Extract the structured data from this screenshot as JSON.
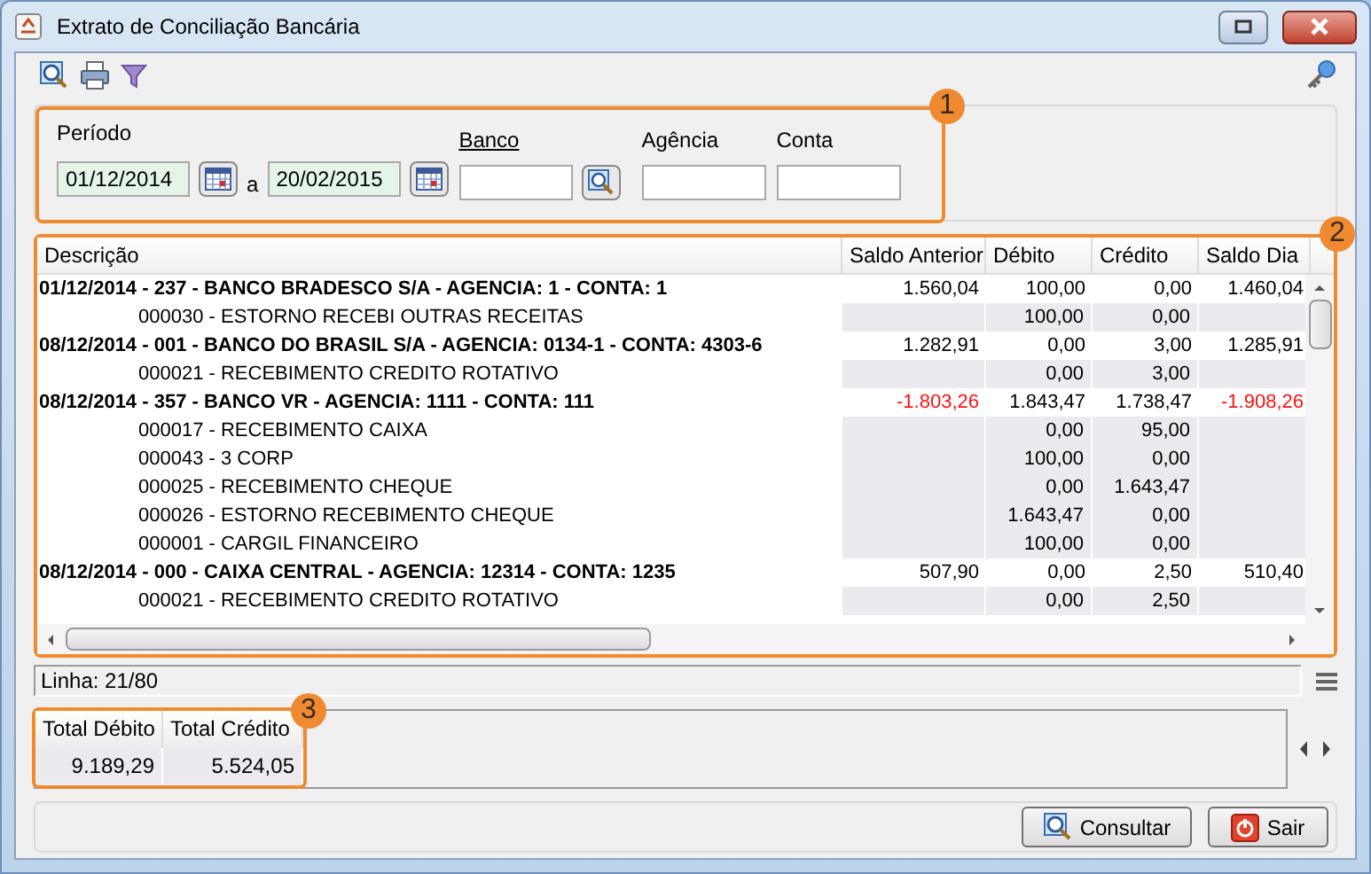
{
  "window": {
    "title": "Extrato de Conciliação Bancária"
  },
  "filters": {
    "periodo_label": "Período",
    "date_from": "01/12/2014",
    "separator": "a",
    "date_to": "20/02/2015",
    "banco_label": "Banco",
    "agencia_label": "Agência",
    "conta_label": "Conta"
  },
  "badges": [
    "1",
    "2",
    "3"
  ],
  "table": {
    "columns": [
      "Descrição",
      "Saldo Anterior",
      "Débito",
      "Crédito",
      "Saldo Dia"
    ],
    "rows": [
      {
        "kind": "group",
        "negative": false,
        "cells": [
          "01/12/2014 - 237 - BANCO BRADESCO S/A  - AGENCIA: 1 - CONTA: 1",
          "1.560,04",
          "100,00",
          "0,00",
          "1.460,04"
        ]
      },
      {
        "kind": "detail",
        "cells": [
          "000030 - ESTORNO RECEBI OUTRAS RECEITAS",
          "",
          "100,00",
          "0,00",
          ""
        ]
      },
      {
        "kind": "group",
        "negative": false,
        "cells": [
          "08/12/2014 - 001 - BANCO DO BRASIL S/A - AGENCIA: 0134-1 - CONTA: 4303-6",
          "1.282,91",
          "0,00",
          "3,00",
          "1.285,91"
        ]
      },
      {
        "kind": "detail",
        "cells": [
          "000021 - RECEBIMENTO CREDITO ROTATIVO",
          "",
          "0,00",
          "3,00",
          ""
        ]
      },
      {
        "kind": "group",
        "negative": true,
        "cells": [
          "08/12/2014 - 357 - BANCO VR - AGENCIA: 1111 - CONTA: 111",
          "-1.803,26",
          "1.843,47",
          "1.738,47",
          "-1.908,26"
        ]
      },
      {
        "kind": "detail",
        "cells": [
          "000017 - RECEBIMENTO CAIXA",
          "",
          "0,00",
          "95,00",
          ""
        ]
      },
      {
        "kind": "detail",
        "cells": [
          "000043 - 3 CORP",
          "",
          "100,00",
          "0,00",
          ""
        ]
      },
      {
        "kind": "detail",
        "cells": [
          "000025 - RECEBIMENTO CHEQUE",
          "",
          "0,00",
          "1.643,47",
          ""
        ]
      },
      {
        "kind": "detail",
        "cells": [
          "000026 - ESTORNO RECEBIMENTO CHEQUE",
          "",
          "1.643,47",
          "0,00",
          ""
        ]
      },
      {
        "kind": "detail",
        "cells": [
          "000001 - CARGIL FINANCEIRO",
          "",
          "100,00",
          "0,00",
          ""
        ]
      },
      {
        "kind": "group",
        "negative": false,
        "cells": [
          "08/12/2014 - 000 - CAIXA CENTRAL - AGENCIA: 12314 - CONTA: 1235",
          "507,90",
          "0,00",
          "2,50",
          "510,40"
        ]
      },
      {
        "kind": "detail",
        "cells": [
          "000021 - RECEBIMENTO CREDITO ROTATIVO",
          "",
          "0,00",
          "2,50",
          ""
        ]
      }
    ]
  },
  "status": "Linha: 21/80",
  "totals": {
    "columns": [
      "Total Débito",
      "Total Crédito"
    ],
    "values": [
      "9.189,29",
      "5.524,05"
    ]
  },
  "buttons": [
    {
      "kind": "search",
      "label": "Consultar"
    },
    {
      "kind": "exit",
      "label": "Sair"
    }
  ]
}
